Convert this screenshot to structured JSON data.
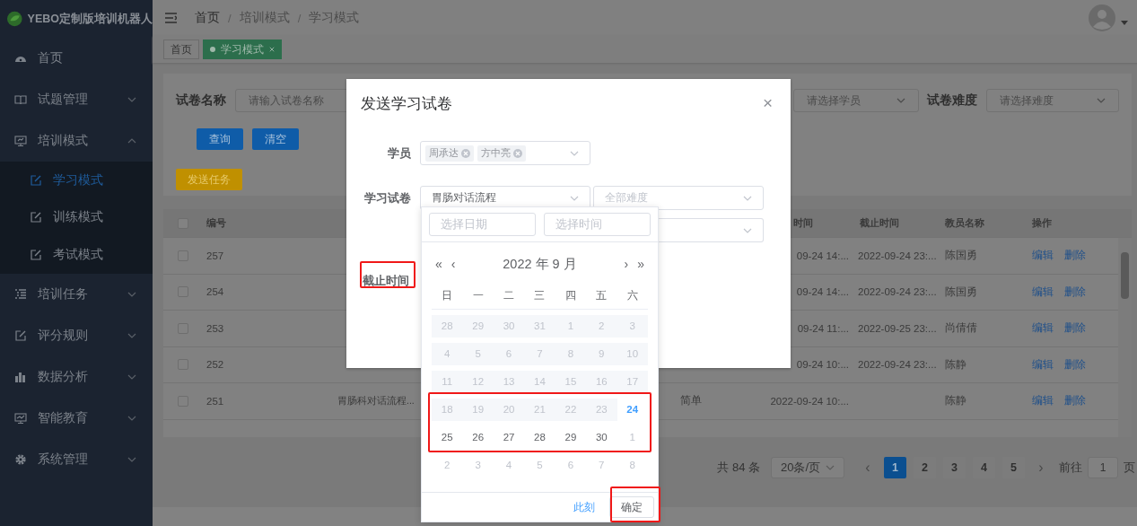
{
  "sidebar": {
    "title": "YEBO定制版培训机器人",
    "items": [
      {
        "label": "首页"
      },
      {
        "label": "试题管理",
        "expanded": false
      },
      {
        "label": "培训模式",
        "expanded": true,
        "children": [
          {
            "label": "学习模式",
            "selected": true
          },
          {
            "label": "训练模式",
            "selected": false
          },
          {
            "label": "考试模式",
            "selected": false
          }
        ]
      },
      {
        "label": "培训任务",
        "expanded": false
      },
      {
        "label": "评分规则",
        "expanded": false
      },
      {
        "label": "数据分析",
        "expanded": false
      },
      {
        "label": "智能教育",
        "expanded": false
      },
      {
        "label": "系统管理",
        "expanded": false
      }
    ]
  },
  "header": {
    "breadcrumb": [
      "首页",
      "培训模式",
      "学习模式"
    ],
    "separator": "/"
  },
  "tags": [
    {
      "label": "首页",
      "selected": false
    },
    {
      "label": "学习模式",
      "selected": true
    }
  ],
  "filters": {
    "name_label": "试卷名称",
    "name_placeholder": "请输入试卷名称",
    "student_placeholder": "请选择学员",
    "difficulty_label": "试卷难度",
    "difficulty_placeholder": "请选择难度",
    "buttons": [
      "查询",
      "清空"
    ],
    "send_button": "发送任务"
  },
  "table": {
    "all_checked": false,
    "columns": {
      "id": "编号",
      "start_time": "时间",
      "end_time": "截止时间",
      "teacher": "教员名称",
      "actions": "操作"
    },
    "rows": [
      {
        "checked": false,
        "id": "257",
        "start_time": "09-24 14:...",
        "end_time": "2022-09-24 23:...",
        "teacher": "陈国勇",
        "actions": [
          "编辑",
          "删除"
        ]
      },
      {
        "checked": false,
        "id": "254",
        "start_time": "09-24 14:...",
        "end_time": "2022-09-24 23:...",
        "teacher": "陈国勇",
        "actions": [
          "编辑",
          "删除"
        ]
      },
      {
        "checked": false,
        "id": "253",
        "start_time": "09-24 11:...",
        "end_time": "2022-09-25 23:...",
        "teacher": "尚倩倩",
        "actions": [
          "编辑",
          "删除"
        ]
      },
      {
        "checked": false,
        "id": "252",
        "start_time": "09-24 10:...",
        "end_time": "2022-09-24 23:...",
        "teacher": "陈静",
        "actions": [
          "编辑",
          "删除"
        ]
      },
      {
        "checked": false,
        "id": "251",
        "name": "胃肠科对话流程...",
        "difficulty": "简单",
        "start_time": "2022-09-24 10:...",
        "teacher": "陈静",
        "actions": [
          "编辑",
          "删除"
        ]
      }
    ]
  },
  "pagination": {
    "total": "共 84 条",
    "page_size": "20条/页",
    "prev": "‹",
    "next": "›",
    "pages": [
      {
        "label": "1",
        "selected": true
      },
      {
        "label": "2",
        "selected": false
      },
      {
        "label": "3",
        "selected": false
      },
      {
        "label": "4",
        "selected": false
      },
      {
        "label": "5",
        "selected": false
      }
    ],
    "goto_label": "前往",
    "goto_value": "1",
    "goto_suffix": "页"
  },
  "dialog": {
    "title": "发送学习试卷",
    "close": "×",
    "student_label": "学员",
    "students": [
      "周承达",
      "方中亮"
    ],
    "paper_label": "学习试卷",
    "paper_value": "胃肠对话流程",
    "difficulty_placeholder": "全部难度",
    "deadline_label": "截止时间"
  },
  "date_picker": {
    "date_placeholder": "选择日期",
    "time_placeholder": "选择时间",
    "prev_year": "«",
    "prev_month": "‹",
    "month_title": "2022 年 9 月",
    "next_month": "›",
    "next_year": "»",
    "weekdays": [
      "日",
      "一",
      "二",
      "三",
      "四",
      "五",
      "六"
    ],
    "weeks": [
      [
        {
          "label": "28",
          "kind": "disabled"
        },
        {
          "label": "29",
          "kind": "disabled"
        },
        {
          "label": "30",
          "kind": "disabled"
        },
        {
          "label": "31",
          "kind": "disabled"
        },
        {
          "label": "1",
          "kind": "disabled"
        },
        {
          "label": "2",
          "kind": "disabled"
        },
        {
          "label": "3",
          "kind": "disabled"
        }
      ],
      [
        {
          "label": "4",
          "kind": "disabled"
        },
        {
          "label": "5",
          "kind": "disabled"
        },
        {
          "label": "6",
          "kind": "disabled"
        },
        {
          "label": "7",
          "kind": "disabled"
        },
        {
          "label": "8",
          "kind": "disabled"
        },
        {
          "label": "9",
          "kind": "disabled"
        },
        {
          "label": "10",
          "kind": "disabled"
        }
      ],
      [
        {
          "label": "11",
          "kind": "disabled"
        },
        {
          "label": "12",
          "kind": "disabled"
        },
        {
          "label": "13",
          "kind": "disabled"
        },
        {
          "label": "14",
          "kind": "disabled"
        },
        {
          "label": "15",
          "kind": "disabled"
        },
        {
          "label": "16",
          "kind": "disabled"
        },
        {
          "label": "17",
          "kind": "disabled"
        }
      ],
      [
        {
          "label": "18",
          "kind": "disabled"
        },
        {
          "label": "19",
          "kind": "disabled"
        },
        {
          "label": "20",
          "kind": "disabled"
        },
        {
          "label": "21",
          "kind": "disabled"
        },
        {
          "label": "22",
          "kind": "disabled"
        },
        {
          "label": "23",
          "kind": "disabled"
        },
        {
          "label": "24",
          "kind": "today"
        }
      ],
      [
        {
          "label": "25",
          "kind": "normal"
        },
        {
          "label": "26",
          "kind": "normal"
        },
        {
          "label": "27",
          "kind": "normal"
        },
        {
          "label": "28",
          "kind": "normal"
        },
        {
          "label": "29",
          "kind": "normal"
        },
        {
          "label": "30",
          "kind": "normal"
        },
        {
          "label": "1",
          "kind": "other"
        }
      ],
      [
        {
          "label": "2",
          "kind": "other"
        },
        {
          "label": "3",
          "kind": "other"
        },
        {
          "label": "4",
          "kind": "other"
        },
        {
          "label": "5",
          "kind": "other"
        },
        {
          "label": "6",
          "kind": "other"
        },
        {
          "label": "7",
          "kind": "other"
        },
        {
          "label": "8",
          "kind": "other"
        }
      ]
    ],
    "now_button": "此刻",
    "confirm_button": "确定"
  }
}
